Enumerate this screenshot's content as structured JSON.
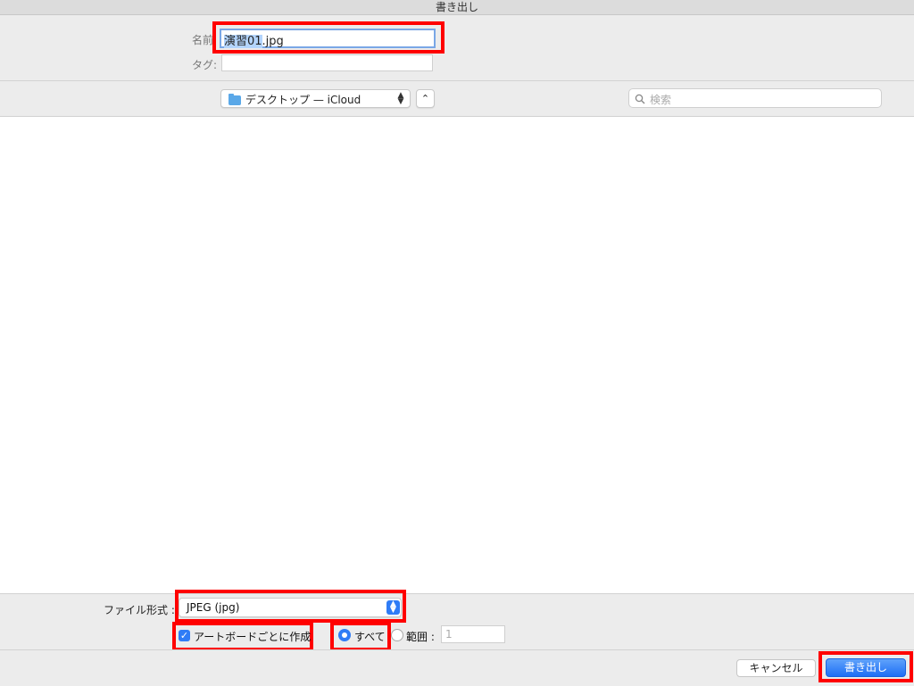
{
  "window": {
    "title": "書き出し"
  },
  "name_panel": {
    "name_label": "名前:",
    "name_value_selected": "演習01",
    "name_value_rest": ".jpg",
    "tags_label": "タグ:",
    "tags_value": ""
  },
  "location_bar": {
    "location": "デスクトップ — iCloud",
    "search_placeholder": "検索"
  },
  "accessory": {
    "format_label": "ファイル形式 :",
    "format_value": "JPEG (jpg)",
    "artboard_checkbox_label": "アートボードごとに作成",
    "artboard_checked": true,
    "radio_all_label": "すべて",
    "radio_range_label": "範囲 :",
    "range_value": "1"
  },
  "buttons": {
    "cancel": "キャンセル",
    "export": "書き出し"
  },
  "colors": {
    "accent": "#2f7cf6",
    "highlight_box": "#ff0000",
    "panel_bg": "#ececec"
  }
}
